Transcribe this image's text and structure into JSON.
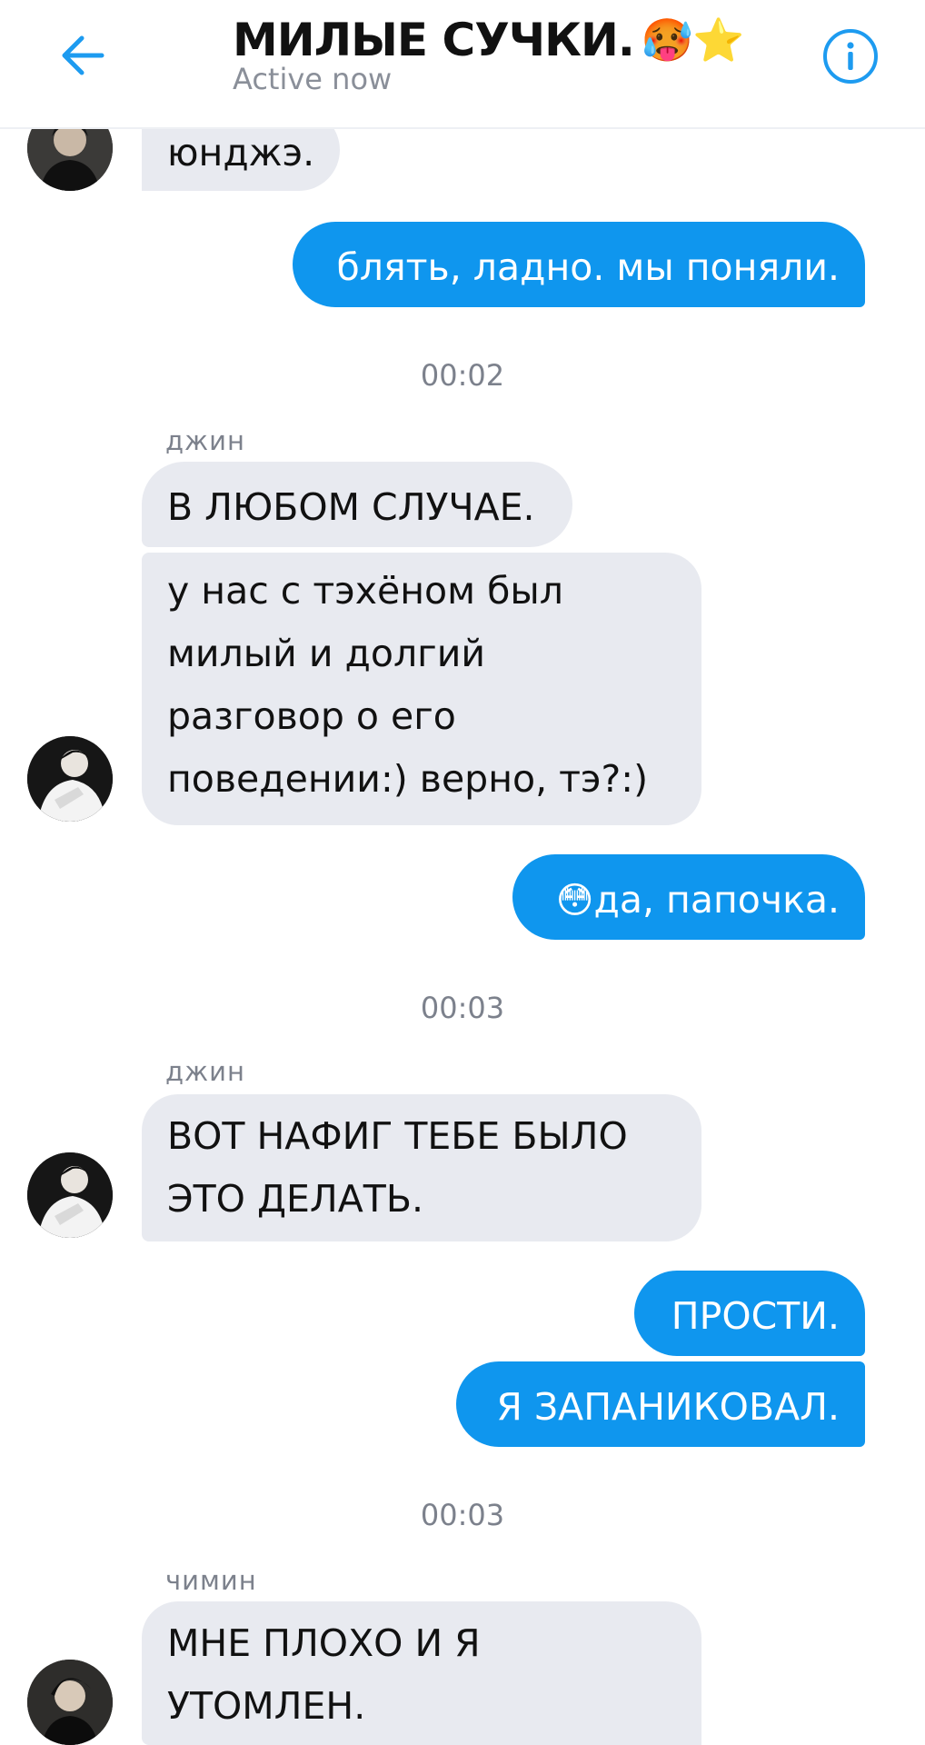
{
  "header": {
    "title": "МИЛЫЕ СУЧКИ.",
    "title_emoji": "🥵⭐",
    "status": "Active now",
    "back_icon": "arrow-left-icon",
    "info_icon": "info-icon"
  },
  "colors": {
    "accent": "#1d9bf0",
    "outgoing_bubble": "#0f96ee",
    "incoming_bubble": "#e8eaf0",
    "meta_text": "#7c818c"
  },
  "messages": {
    "m1": {
      "direction": "incoming",
      "text": "юнджэ."
    },
    "m2": {
      "direction": "outgoing",
      "text": "блять, ладно. мы поняли."
    },
    "t1": "00:02",
    "s1": "джин",
    "m3": {
      "direction": "incoming",
      "text": "В ЛЮБОМ СЛУЧАЕ."
    },
    "m4": {
      "direction": "incoming",
      "lines": [
        "у нас с тэхёном был",
        "милый и долгий",
        "разговор о его",
        "поведении:) верно, тэ?:)"
      ]
    },
    "m5": {
      "direction": "outgoing",
      "emoji": "😳",
      "text": "да, папочка."
    },
    "t2": "00:03",
    "s2": "джин",
    "m6": {
      "direction": "incoming",
      "lines": [
        "ВОТ НАФИГ ТЕБЕ БЫЛО",
        "ЭТО ДЕЛАТЬ."
      ]
    },
    "m7": {
      "direction": "outgoing",
      "text": "ПРОСТИ."
    },
    "m8": {
      "direction": "outgoing",
      "text": "Я ЗАПАНИКОВАЛ."
    },
    "t3": "00:03",
    "s3": "чимин",
    "m9": {
      "direction": "incoming",
      "lines": [
        "МНЕ ПЛОХО И Я",
        "УТОМЛЕН."
      ]
    }
  }
}
